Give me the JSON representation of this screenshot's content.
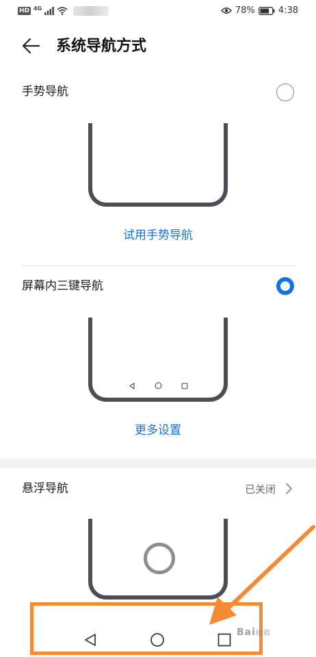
{
  "status_bar": {
    "hd": "HD",
    "network": "4G",
    "visibility_icon": "eye-icon",
    "battery_percent": "78%",
    "time": "4:38"
  },
  "header": {
    "back_icon": "arrow-left-icon",
    "title": "系统导航方式"
  },
  "options": [
    {
      "label": "手势导航",
      "selected": false,
      "action": "试用手势导航"
    },
    {
      "label": "屏幕内三键导航",
      "selected": true,
      "action": "更多设置"
    }
  ],
  "floating_nav": {
    "label": "悬浮导航",
    "status": "已关闭"
  },
  "watermark": {
    "text": "Bai",
    "sub": "经验"
  },
  "colors": {
    "accent": "#1273e6",
    "link": "#1a72c9",
    "annotation": "#f58a35",
    "phone_frame": "#4b4e57"
  }
}
